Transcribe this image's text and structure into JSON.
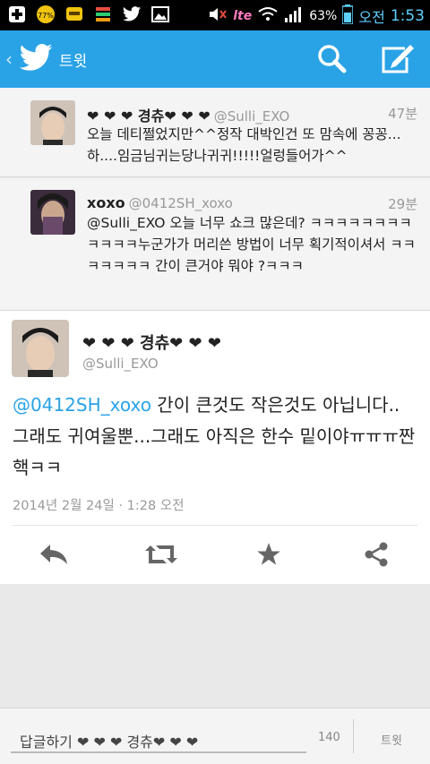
{
  "status_bar": {
    "battery_level": "77%",
    "battery_percent": "63%",
    "network": "lte",
    "time_period": "오전",
    "time": "1:53"
  },
  "nav": {
    "title": "트윗",
    "icons": [
      "back-icon",
      "twitter-logo-icon",
      "search-icon",
      "compose-icon"
    ]
  },
  "conversation": [
    {
      "name": "❤ ❤ ❤ 경츄❤ ❤ ❤",
      "handle": "@Sulli_EXO",
      "time": "47분",
      "text": "오늘 데티쩔었지만^^정작 대박인건 또 맘속에 꽁꽁...하....임금님귀는당나귀귀!!!!!얼렁들어가^^"
    },
    {
      "name": "xoxo",
      "handle": "@0412SH_xoxo",
      "time": "29분",
      "text": "@Sulli_EXO 오늘 너무 쇼크 많은데? ㅋㅋㅋㅋㅋㅋㅋㅋㅋㅋㅋㅋ누군가가 머리쓴 방법이 너무 획기적이셔서 ㅋㅋㅋㅋㅋㅋㅋ 간이 큰거야 뭐야 ?ㅋㅋㅋ"
    }
  ],
  "main_tweet": {
    "name": "❤ ❤ ❤ 경츄❤ ❤ ❤",
    "handle": "@Sulli_EXO",
    "mention": "@0412SH_xoxo",
    "text": " 간이 큰것도 작은것도 아닙니다.. 그래도 귀여울뿐...그래도 아직은 한수 밑이야ㅠㅠㅠ짠핵ㅋㅋ",
    "timestamp": "2014년 2월 24일 · 1:28 오전",
    "actions": [
      "reply-icon",
      "retweet-icon",
      "favorite-star-icon",
      "share-icon"
    ]
  },
  "reply_bar": {
    "placeholder": "답글하기 ❤ ❤ ❤ 경츄❤ ❤ ❤",
    "char_count": "140",
    "button": "트윗"
  },
  "colors": {
    "accent": "#2aa3e6",
    "text": "#222222",
    "muted": "#999999"
  }
}
